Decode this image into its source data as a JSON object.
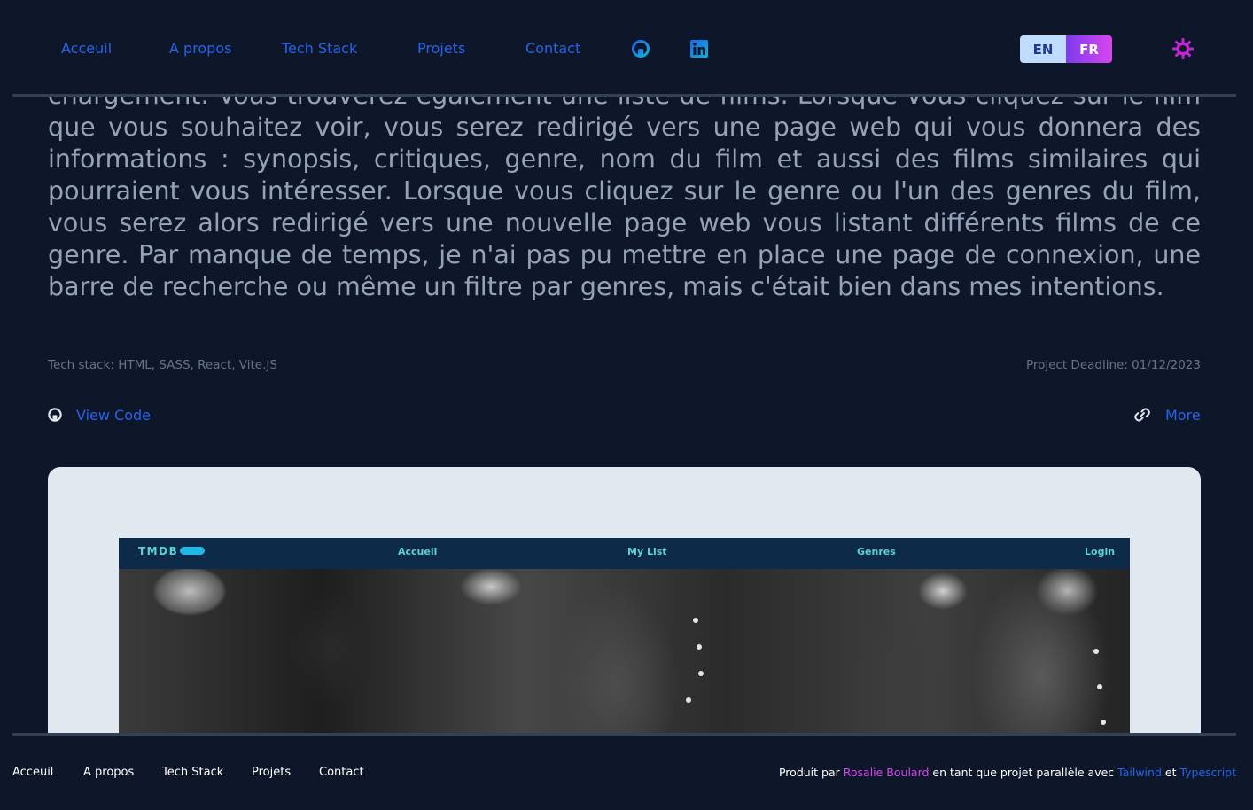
{
  "nav": {
    "links": [
      "Acceuil",
      "A propos",
      "Tech Stack",
      "Projets",
      "Contact"
    ],
    "icons": [
      "github-icon",
      "linkedin-icon"
    ],
    "lang": {
      "en": "EN",
      "fr": "FR",
      "active": "FR"
    },
    "theme_icon": "sun-icon"
  },
  "project": {
    "description": "chargement. Vous trouverez également une liste de films. Lorsque vous cliquez sur le film que vous souhaitez voir, vous serez redirigé vers une page web qui vous donnera des informations : synopsis, critiques, genre, nom du film et aussi des films similaires qui pourraient vous intéresser. Lorsque vous cliquez sur le genre ou l'un des genres du film, vous serez alors redirigé vers une nouvelle page web vous listant différents films de ce genre. Par manque de temps, je n'ai pas pu mettre en place une page de connexion, une barre de recherche ou même un filtre par genres, mais c'était bien dans mes intentions.",
    "tech_stack": "Tech stack: HTML, SASS, React, Vite.JS",
    "deadline": "Project Deadline: 01/12/2023",
    "view_code": "View Code",
    "more": "More",
    "preview": {
      "logo": "TMDB",
      "links": [
        "Accueil",
        "My List",
        "Genres",
        "Login"
      ]
    }
  },
  "footer": {
    "links": [
      "Acceuil",
      "A propos",
      "Tech Stack",
      "Projets",
      "Contact"
    ],
    "credit_prefix": "Produit par",
    "author": "Rosalie Boulard",
    "credit_middle": "en tant que projet parallèle avec",
    "tool1": "Tailwind",
    "credit_and": "et",
    "tool2": "Typescript"
  },
  "colors": {
    "background": "#0e1729",
    "link": "#2563eb",
    "accent": "#d946ef",
    "text_muted": "#94a3b8"
  }
}
